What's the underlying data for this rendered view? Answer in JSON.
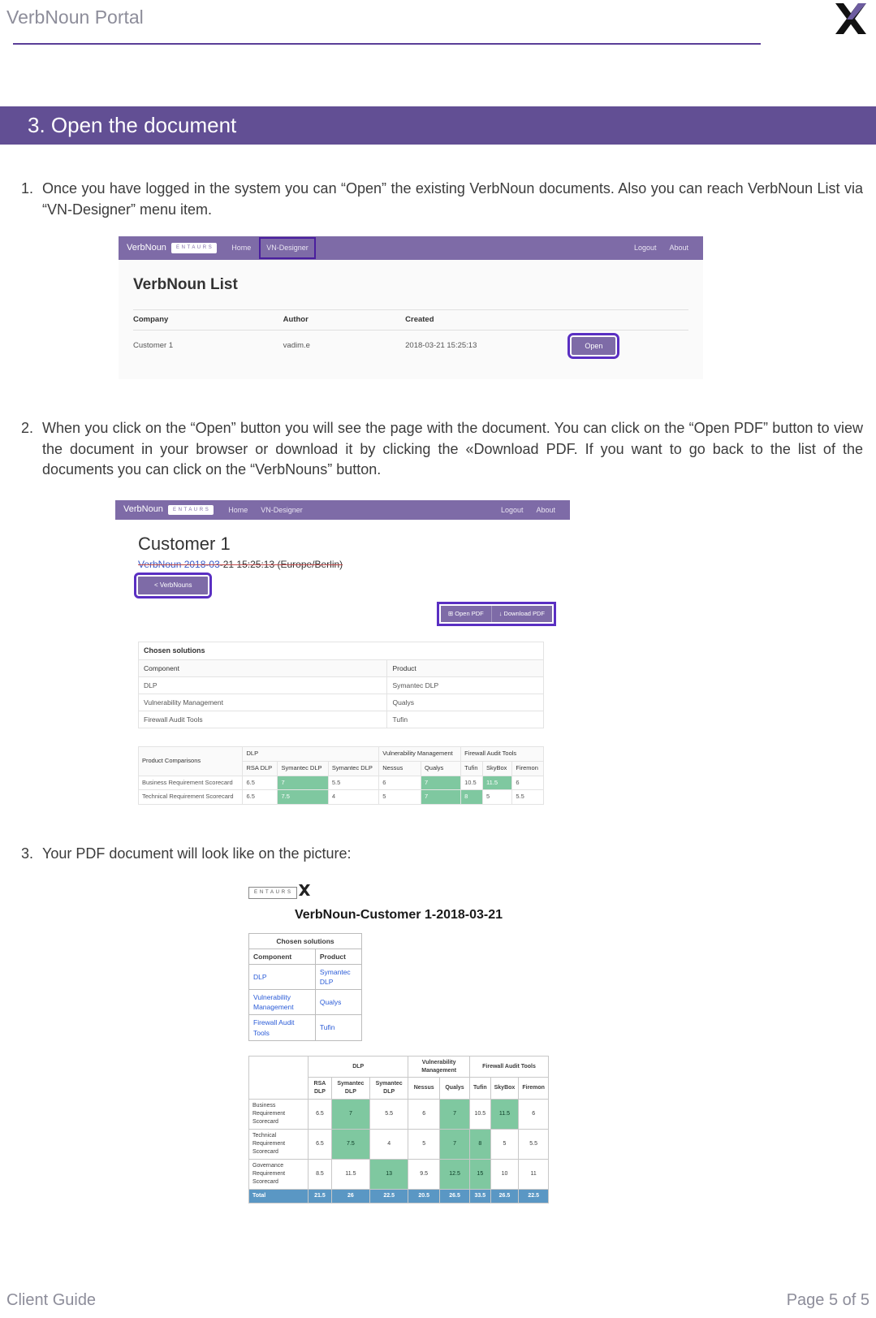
{
  "header": {
    "title": "VerbNoun Portal"
  },
  "section": {
    "title": "3. Open the document"
  },
  "steps": {
    "s1": "Once you have logged in the system you can “Open” the existing VerbNoun documents. Also you can reach VerbNoun List via “VN-Designer” menu item.",
    "s2": "When you click on the “Open” button you will see the page with the document. You can click on the “Open PDF” button to view the document in your browser or download it by clicking the «Download PDF. If you want to go back to the list of the documents you can click on the “VerbNouns” button.",
    "s3": "Your PDF document will look like on the picture:"
  },
  "nav": {
    "brand": "VerbNoun",
    "brand_mini": "E N T A U R S",
    "home": "Home",
    "vndesigner": "VN-Designer",
    "logout": "Logout",
    "about": "About"
  },
  "shot1": {
    "heading": "VerbNoun List",
    "cols": {
      "company": "Company",
      "author": "Author",
      "created": "Created"
    },
    "row": {
      "company": "Customer 1",
      "author": "vadim.e",
      "created": "2018-03-21 15:25:13"
    },
    "open": "Open"
  },
  "shot2": {
    "customer": "Customer 1",
    "sub_strike": "VerbNoun 2018-03",
    "sub_tail": "-21 15:25:13 (Europe/Berlin)",
    "back": "< VerbNouns",
    "open_pdf": "⊞ Open PDF",
    "download_pdf": "↓ Download PDF",
    "chosen_caption": "Chosen solutions",
    "chosen_cols": {
      "component": "Component",
      "product": "Product"
    },
    "chosen_rows": [
      {
        "component": "DLP",
        "product": "Symantec DLP"
      },
      {
        "component": "Vulnerability Management",
        "product": "Qualys"
      },
      {
        "component": "Firewall Audit Tools",
        "product": "Tufin"
      }
    ],
    "comp": {
      "head_pc": "Product Comparisons",
      "groups": [
        "DLP",
        "Vulnerability Management",
        "Firewall Audit Tools"
      ],
      "sub": [
        "RSA DLP",
        "Symantec DLP",
        "Symantec DLP",
        "Nessus",
        "Qualys",
        "Tufin",
        "SkyBox",
        "Firemon"
      ],
      "rows": [
        {
          "name": "Business Requirement Scorecard",
          "vals": [
            "6.5",
            "7",
            "5.5",
            "6",
            "7",
            "10.5",
            "11.5",
            "6"
          ],
          "hl": [
            1,
            4,
            6
          ]
        },
        {
          "name": "Technical Requirement Scorecard",
          "vals": [
            "6.5",
            "7.5",
            "4",
            "5",
            "7",
            "8",
            "5",
            "5.5"
          ],
          "hl": [
            1,
            4,
            5
          ]
        }
      ]
    }
  },
  "shot3": {
    "title": "VerbNoun-Customer 1-2018-03-21",
    "chosen_caption": "Chosen solutions",
    "chosen_cols": {
      "component": "Component",
      "product": "Product"
    },
    "chosen_rows": [
      {
        "component": "DLP",
        "product": "Symantec DLP"
      },
      {
        "component": "Vulnerability Management",
        "product": "Qualys"
      },
      {
        "component": "Firewall Audit Tools",
        "product": "Tufin"
      }
    ],
    "comp": {
      "groups": [
        "DLP",
        "Vulnerability Management",
        "Firewall Audit Tools"
      ],
      "sub": [
        "RSA DLP",
        "Symantec DLP",
        "Symantec DLP",
        "Nessus",
        "Qualys",
        "Tufin",
        "SkyBox",
        "Firemon"
      ],
      "rows": [
        {
          "name": "Business Requirement Scorecard",
          "vals": [
            "6.5",
            "7",
            "5.5",
            "6",
            "7",
            "10.5",
            "11.5",
            "6"
          ],
          "hl": [
            1,
            4,
            6
          ]
        },
        {
          "name": "Technical Requirement Scorecard",
          "vals": [
            "6.5",
            "7.5",
            "4",
            "5",
            "7",
            "8",
            "5",
            "5.5"
          ],
          "hl": [
            1,
            4,
            5
          ]
        },
        {
          "name": "Governance Requirement Scorecard",
          "vals": [
            "8.5",
            "11.5",
            "13",
            "9.5",
            "12.5",
            "15",
            "10",
            "11"
          ],
          "hl": [
            2,
            4,
            5
          ]
        }
      ],
      "total": {
        "name": "Total",
        "vals": [
          "21.5",
          "26",
          "22.5",
          "20.5",
          "26.5",
          "33.5",
          "26.5",
          "22.5"
        ]
      }
    }
  },
  "footer": {
    "left": "Client Guide",
    "right": "Page 5 of 5"
  }
}
